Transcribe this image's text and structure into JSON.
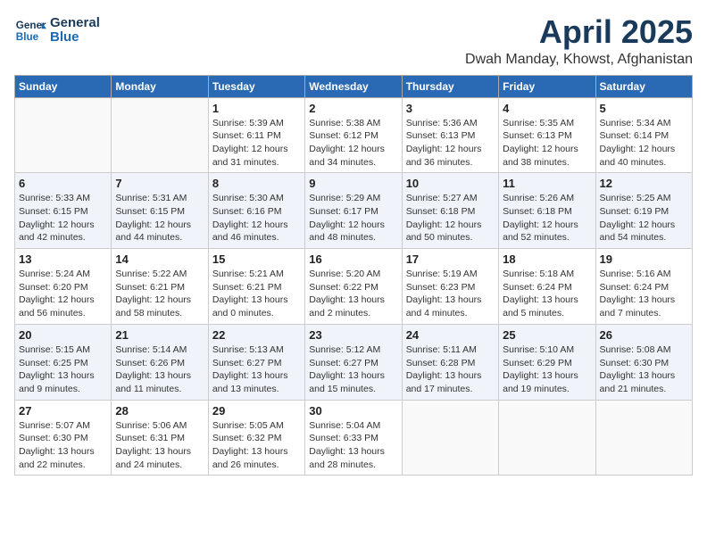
{
  "header": {
    "logo_line1": "General",
    "logo_line2": "Blue",
    "title": "April 2025",
    "subtitle": "Dwah Manday, Khowst, Afghanistan"
  },
  "days_of_week": [
    "Sunday",
    "Monday",
    "Tuesday",
    "Wednesday",
    "Thursday",
    "Friday",
    "Saturday"
  ],
  "weeks": [
    [
      {
        "day": "",
        "info": ""
      },
      {
        "day": "",
        "info": ""
      },
      {
        "day": "1",
        "info": "Sunrise: 5:39 AM\nSunset: 6:11 PM\nDaylight: 12 hours and 31 minutes."
      },
      {
        "day": "2",
        "info": "Sunrise: 5:38 AM\nSunset: 6:12 PM\nDaylight: 12 hours and 34 minutes."
      },
      {
        "day": "3",
        "info": "Sunrise: 5:36 AM\nSunset: 6:13 PM\nDaylight: 12 hours and 36 minutes."
      },
      {
        "day": "4",
        "info": "Sunrise: 5:35 AM\nSunset: 6:13 PM\nDaylight: 12 hours and 38 minutes."
      },
      {
        "day": "5",
        "info": "Sunrise: 5:34 AM\nSunset: 6:14 PM\nDaylight: 12 hours and 40 minutes."
      }
    ],
    [
      {
        "day": "6",
        "info": "Sunrise: 5:33 AM\nSunset: 6:15 PM\nDaylight: 12 hours and 42 minutes."
      },
      {
        "day": "7",
        "info": "Sunrise: 5:31 AM\nSunset: 6:15 PM\nDaylight: 12 hours and 44 minutes."
      },
      {
        "day": "8",
        "info": "Sunrise: 5:30 AM\nSunset: 6:16 PM\nDaylight: 12 hours and 46 minutes."
      },
      {
        "day": "9",
        "info": "Sunrise: 5:29 AM\nSunset: 6:17 PM\nDaylight: 12 hours and 48 minutes."
      },
      {
        "day": "10",
        "info": "Sunrise: 5:27 AM\nSunset: 6:18 PM\nDaylight: 12 hours and 50 minutes."
      },
      {
        "day": "11",
        "info": "Sunrise: 5:26 AM\nSunset: 6:18 PM\nDaylight: 12 hours and 52 minutes."
      },
      {
        "day": "12",
        "info": "Sunrise: 5:25 AM\nSunset: 6:19 PM\nDaylight: 12 hours and 54 minutes."
      }
    ],
    [
      {
        "day": "13",
        "info": "Sunrise: 5:24 AM\nSunset: 6:20 PM\nDaylight: 12 hours and 56 minutes."
      },
      {
        "day": "14",
        "info": "Sunrise: 5:22 AM\nSunset: 6:21 PM\nDaylight: 12 hours and 58 minutes."
      },
      {
        "day": "15",
        "info": "Sunrise: 5:21 AM\nSunset: 6:21 PM\nDaylight: 13 hours and 0 minutes."
      },
      {
        "day": "16",
        "info": "Sunrise: 5:20 AM\nSunset: 6:22 PM\nDaylight: 13 hours and 2 minutes."
      },
      {
        "day": "17",
        "info": "Sunrise: 5:19 AM\nSunset: 6:23 PM\nDaylight: 13 hours and 4 minutes."
      },
      {
        "day": "18",
        "info": "Sunrise: 5:18 AM\nSunset: 6:24 PM\nDaylight: 13 hours and 5 minutes."
      },
      {
        "day": "19",
        "info": "Sunrise: 5:16 AM\nSunset: 6:24 PM\nDaylight: 13 hours and 7 minutes."
      }
    ],
    [
      {
        "day": "20",
        "info": "Sunrise: 5:15 AM\nSunset: 6:25 PM\nDaylight: 13 hours and 9 minutes."
      },
      {
        "day": "21",
        "info": "Sunrise: 5:14 AM\nSunset: 6:26 PM\nDaylight: 13 hours and 11 minutes."
      },
      {
        "day": "22",
        "info": "Sunrise: 5:13 AM\nSunset: 6:27 PM\nDaylight: 13 hours and 13 minutes."
      },
      {
        "day": "23",
        "info": "Sunrise: 5:12 AM\nSunset: 6:27 PM\nDaylight: 13 hours and 15 minutes."
      },
      {
        "day": "24",
        "info": "Sunrise: 5:11 AM\nSunset: 6:28 PM\nDaylight: 13 hours and 17 minutes."
      },
      {
        "day": "25",
        "info": "Sunrise: 5:10 AM\nSunset: 6:29 PM\nDaylight: 13 hours and 19 minutes."
      },
      {
        "day": "26",
        "info": "Sunrise: 5:08 AM\nSunset: 6:30 PM\nDaylight: 13 hours and 21 minutes."
      }
    ],
    [
      {
        "day": "27",
        "info": "Sunrise: 5:07 AM\nSunset: 6:30 PM\nDaylight: 13 hours and 22 minutes."
      },
      {
        "day": "28",
        "info": "Sunrise: 5:06 AM\nSunset: 6:31 PM\nDaylight: 13 hours and 24 minutes."
      },
      {
        "day": "29",
        "info": "Sunrise: 5:05 AM\nSunset: 6:32 PM\nDaylight: 13 hours and 26 minutes."
      },
      {
        "day": "30",
        "info": "Sunrise: 5:04 AM\nSunset: 6:33 PM\nDaylight: 13 hours and 28 minutes."
      },
      {
        "day": "",
        "info": ""
      },
      {
        "day": "",
        "info": ""
      },
      {
        "day": "",
        "info": ""
      }
    ]
  ]
}
